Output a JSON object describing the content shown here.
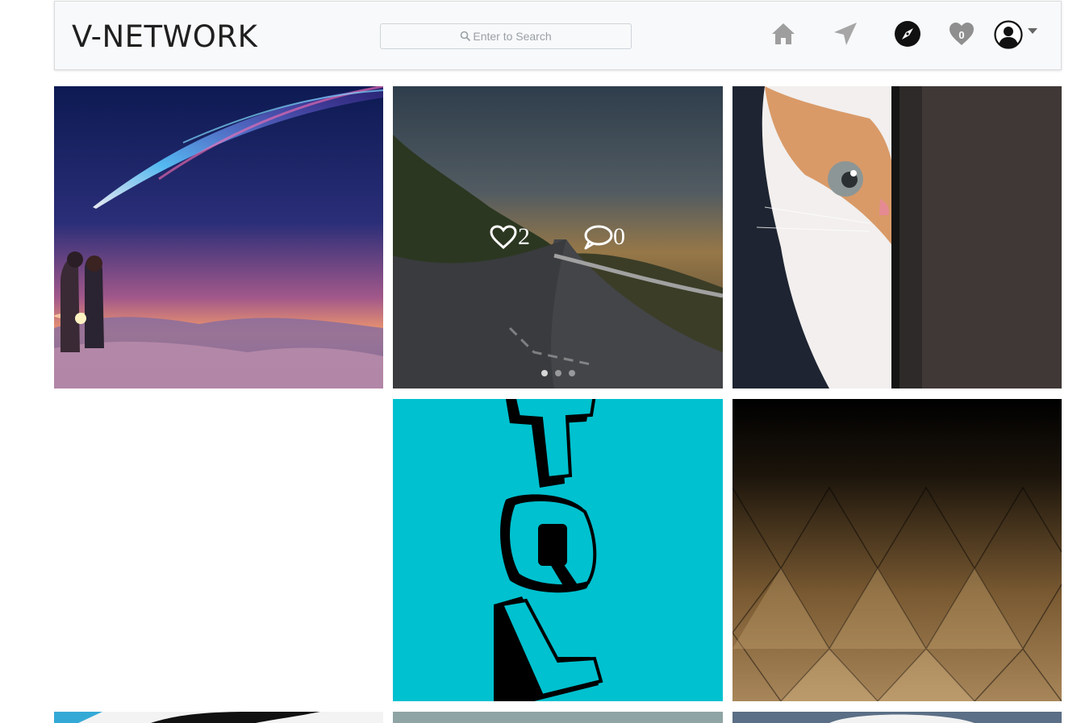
{
  "header": {
    "brand": "V-NETWORK",
    "search_placeholder": "Enter to Search",
    "notifications_count": "0"
  },
  "icons": {
    "home": "home-icon",
    "direct": "send-icon",
    "explore": "compass-icon",
    "activity": "heart-icon",
    "profile": "avatar-icon",
    "profile_caret": "caret-down-icon"
  },
  "posts": [
    {
      "subject": "anime couple under comet sky"
    },
    {
      "subject": "mountain road at sunset",
      "likes": "2",
      "comments": "0",
      "carousel_slides": 3,
      "active_slide": 1
    },
    {
      "subject": "white kitten peeking behind door"
    },
    {
      "subject": "TQL letters on cyan"
    },
    {
      "subject": "gold geometric triangles"
    }
  ],
  "colors": {
    "navbar_bg": "#f8f9fa",
    "brand": "#1f1f1f",
    "cyan": "#00c1cf"
  }
}
